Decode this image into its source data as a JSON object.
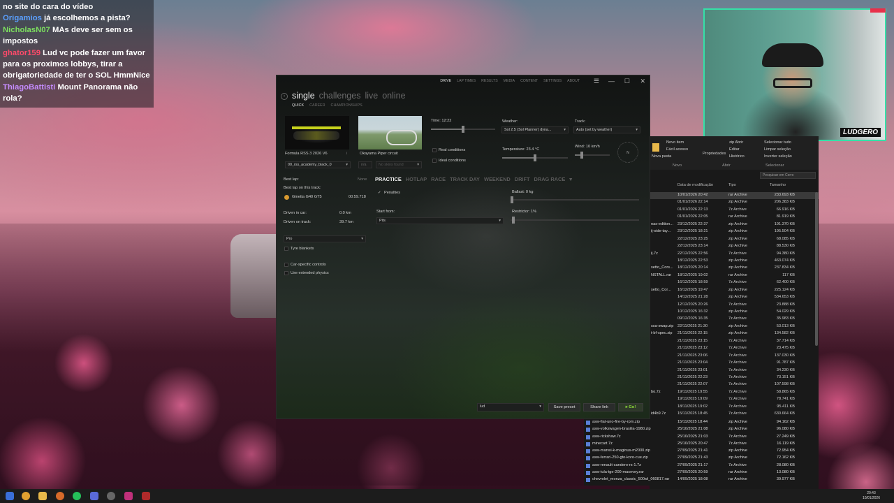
{
  "chat": [
    {
      "user": "",
      "msg": "no site do cara do vídeo"
    },
    {
      "user": "Origamios",
      "msg": "já escolhemos a pista?"
    },
    {
      "user": "NicholasN07",
      "msg": "MAs deve ser sem os impostos"
    },
    {
      "user": "ghator159",
      "msg": "Lud vc pode fazer um favor para os proximos lobbys, tirar a obrigatoriedade de ter o SOL HmmNice"
    },
    {
      "user": "ThiagoBattisti",
      "msg": "Mount Panorama não rola?"
    }
  ],
  "webcam": {
    "logo": "LUDGERO"
  },
  "game": {
    "topnav": [
      "DRIVE",
      "LAP TIMES",
      "RESULTS",
      "MEDIA",
      "CONTENT",
      "SETTINGS",
      "ABOUT"
    ],
    "active_nav": "DRIVE",
    "modes": [
      "single",
      "challenges",
      "live",
      "online"
    ],
    "submodes": [
      "QUICK",
      "CAREER",
      "CHAMPIONSHIPS"
    ],
    "car_name": "Formula RSS 3 2026 V6",
    "track_name": "Okayama Piper circuit",
    "skin": "00_rss_academy_black_0",
    "skin_small": "n/a",
    "skin_placeholder": "No skins found",
    "time_label": "Time: 12:22",
    "weather_label": "Weather:",
    "weather_value": "Sol 2.5 (Sol Planner) dyna...",
    "track_label": "Track:",
    "track_value": "Auto (set by weather)",
    "real_conditions": "Real conditions",
    "ideal_conditions": "Ideal conditions",
    "temperature": "Temperature: 23.4 °C",
    "wind": "Wind: 10 km/h",
    "compass": "N",
    "best_lap": "Best lap:",
    "best_lap_value": "None",
    "best_on_track": "Best lap on this track:",
    "best_car": "Ginetta G40 GT5",
    "best_time": "00:59.718",
    "driven_car_label": "Driven in car:",
    "driven_car_value": "0.0 km",
    "driven_track_label": "Driven on track:",
    "driven_track_value": "39.7 km",
    "assists": "Pro",
    "tyre_blankets": "Tyre blankets",
    "car_controls": "Car-specific controls",
    "ext_physics": "Use extended physics",
    "tabs": [
      "PRACTICE",
      "HOTLAP",
      "RACE",
      "TRACK DAY",
      "WEEKEND",
      "DRIFT",
      "DRAG RACE"
    ],
    "active_tab": "PRACTICE",
    "penalties": "Penalties",
    "ballast": "Ballast: 0 kg",
    "start_from": "Start from:",
    "start_value": "Pits",
    "restrictor": "Restrictor: 1%",
    "preset": "lud",
    "save_preset": "Save preset",
    "share_link": "Share link",
    "go": "Go!",
    "time_level": 0.5,
    "temp_level": 0.5,
    "wind_level": 0.2
  },
  "explorer": {
    "ribbon": {
      "new_item": "Novo item",
      "easy_access": "Fácil acesso",
      "new_folder": "Nova pasta",
      "properties": "Propriedades",
      "edit": "Editar",
      "history": "Histórico",
      "select_all": "Selecionar tudo",
      "clear_selection": "Limpar seleção",
      "invert_selection": "Inverter seleção",
      "zip": "zip Abrir",
      "grp_new": "Novo",
      "grp_open": "Abrir",
      "grp_select": "Selecionar"
    },
    "search_placeholder": "Pesquisar em Cerro",
    "headers": {
      "date": "Data de modificação",
      "type": "Tipo",
      "size": "Tamanho"
    },
    "rows": [
      {
        "n": "",
        "d": "10/01/2026 20:42",
        "t": "rar Archive",
        "s": "233.693 KB",
        "sel": true
      },
      {
        "n": "",
        "d": "01/01/2026 22:14",
        "t": "zip Archive",
        "s": "206.383 KB"
      },
      {
        "n": "",
        "d": "01/01/2026 22:13",
        "t": "7z Archive",
        "s": "66.916 KB"
      },
      {
        "n": "",
        "d": "01/01/2026 22:05",
        "t": "rar Archive",
        "s": "81.919 KB"
      },
      {
        "n": "nas-edition...",
        "d": "23/12/2025 22:37",
        "t": "zip Archive",
        "s": "191.370 KB"
      },
      {
        "n": "ij-side-tay...",
        "d": "23/12/2025 18:21",
        "t": "zip Archive",
        "s": "195.504 KB"
      },
      {
        "n": "",
        "d": "22/12/2025 23:25",
        "t": "zip Archive",
        "s": "68.085 KB"
      },
      {
        "n": "",
        "d": "22/12/2025 23:14",
        "t": "zip Archive",
        "s": "88.530 KB"
      },
      {
        "n": "ij.7z",
        "d": "22/12/2025 22:56",
        "t": "7z Archive",
        "s": "94.380 KB"
      },
      {
        "n": "",
        "d": "18/12/2025 22:53",
        "t": "zip Archive",
        "s": "463.074 KB"
      },
      {
        "n": "setto_Cors...",
        "d": "18/12/2025 20:14",
        "t": "zip Archive",
        "s": "237.834 KB"
      },
      {
        "n": "NSTALL.rar",
        "d": "18/12/2025 19:02",
        "t": "rar Archive",
        "s": "117 KB"
      },
      {
        "n": "",
        "d": "16/12/2025 18:59",
        "t": "7z Archive",
        "s": "62.400 KB"
      },
      {
        "n": "setto_Cor...",
        "d": "16/12/2025 19:47",
        "t": "zip Archive",
        "s": "225.124 KB"
      },
      {
        "n": "",
        "d": "14/12/2025 21:28",
        "t": "zip Archive",
        "s": "534.653 KB"
      },
      {
        "n": "",
        "d": "12/12/2025 20:26",
        "t": "7z Archive",
        "s": "23.888 KB"
      },
      {
        "n": "",
        "d": "10/12/2025 16:32",
        "t": "zip Archive",
        "s": "54.029 KB"
      },
      {
        "n": "",
        "d": "09/12/2025 16:35",
        "t": "7z Archive",
        "s": "35.983 KB"
      },
      {
        "n": "ssa-swap.zip",
        "d": "22/11/2025 21:30",
        "t": "zip Archive",
        "s": "53.013 KB"
      },
      {
        "n": "t-bf-spec.zip",
        "d": "21/11/2025 22:15",
        "t": "zip Archive",
        "s": "134.582 KB"
      },
      {
        "n": "",
        "d": "21/11/2025 23:15",
        "t": "7z Archive",
        "s": "37.714 KB"
      },
      {
        "n": "",
        "d": "21/11/2025 23:12",
        "t": "7z Archive",
        "s": "23.475 KB"
      },
      {
        "n": "",
        "d": "21/11/2025 23:06",
        "t": "7z Archive",
        "s": "137.030 KB"
      },
      {
        "n": "",
        "d": "21/11/2025 23:04",
        "t": "7z Archive",
        "s": "91.787 KB"
      },
      {
        "n": "",
        "d": "21/11/2025 23:01",
        "t": "7z Archive",
        "s": "34.230 KB"
      },
      {
        "n": "",
        "d": "21/11/2025 22:23",
        "t": "7z Archive",
        "s": "73.151 KB"
      },
      {
        "n": "",
        "d": "21/11/2025 22:07",
        "t": "7z Archive",
        "s": "107.598 KB"
      },
      {
        "n": "bo.7z",
        "d": "19/11/2025 19:55",
        "t": "7z Archive",
        "s": "58.865 KB"
      },
      {
        "n": "",
        "d": "19/11/2025 19:09",
        "t": "7z Archive",
        "s": "78.741 KB"
      },
      {
        "n": "",
        "d": "18/11/2025 19:02",
        "t": "7z Archive",
        "s": "95.411 KB"
      },
      {
        "n": "id4b9.7z",
        "d": "15/11/2025 18:45",
        "t": "7z Archive",
        "s": "630.664 KB"
      }
    ],
    "files": [
      {
        "n": "asw-fiat-uno-fire-by-rpm.zip",
        "d": "15/11/2025 18:44",
        "t": "zip Archive",
        "s": "94.162 KB"
      },
      {
        "n": "asw-volkswagen-brasilia-1980.zip",
        "d": "25/10/2025 21:08",
        "t": "zip Archive",
        "s": "96.080 KB"
      },
      {
        "n": "asw-rickshaw.7z",
        "d": "25/10/2025 21:03",
        "t": "7z Archive",
        "s": "27.249 KB"
      },
      {
        "n": "minecart.7z",
        "d": "25/10/2025 20:47",
        "t": "7z Archive",
        "s": "16.119 KB"
      },
      {
        "n": "asw-marrei-k-maginus-m2000.zip",
        "d": "27/09/2025 21:41",
        "t": "zip Archive",
        "s": "72.954 KB"
      },
      {
        "n": "asw-ferrari-250-gto-koro-cue.zip",
        "d": "27/09/2025 21:43",
        "t": "zip Archive",
        "s": "72.162 KB"
      },
      {
        "n": "asw-renault-sandero-rs-1.7z",
        "d": "27/09/2025 21:17",
        "t": "7z Archive",
        "s": "28.080 KB"
      },
      {
        "n": "asw-tula-tge-200-maxevey.rar",
        "d": "27/09/2025 20:59",
        "t": "rar Archive",
        "s": "13.080 KB"
      },
      {
        "n": "chevrolet_monza_classic_500wl_060817.rar",
        "d": "14/09/2025 18:08",
        "t": "rar Archive",
        "s": "39.977 KB"
      }
    ]
  },
  "taskbar": {
    "time": "20:43",
    "date": "10/01/2026"
  },
  "colors": {
    "accent_go": "#8fe03a",
    "webcam_border": "#35e0a8"
  }
}
